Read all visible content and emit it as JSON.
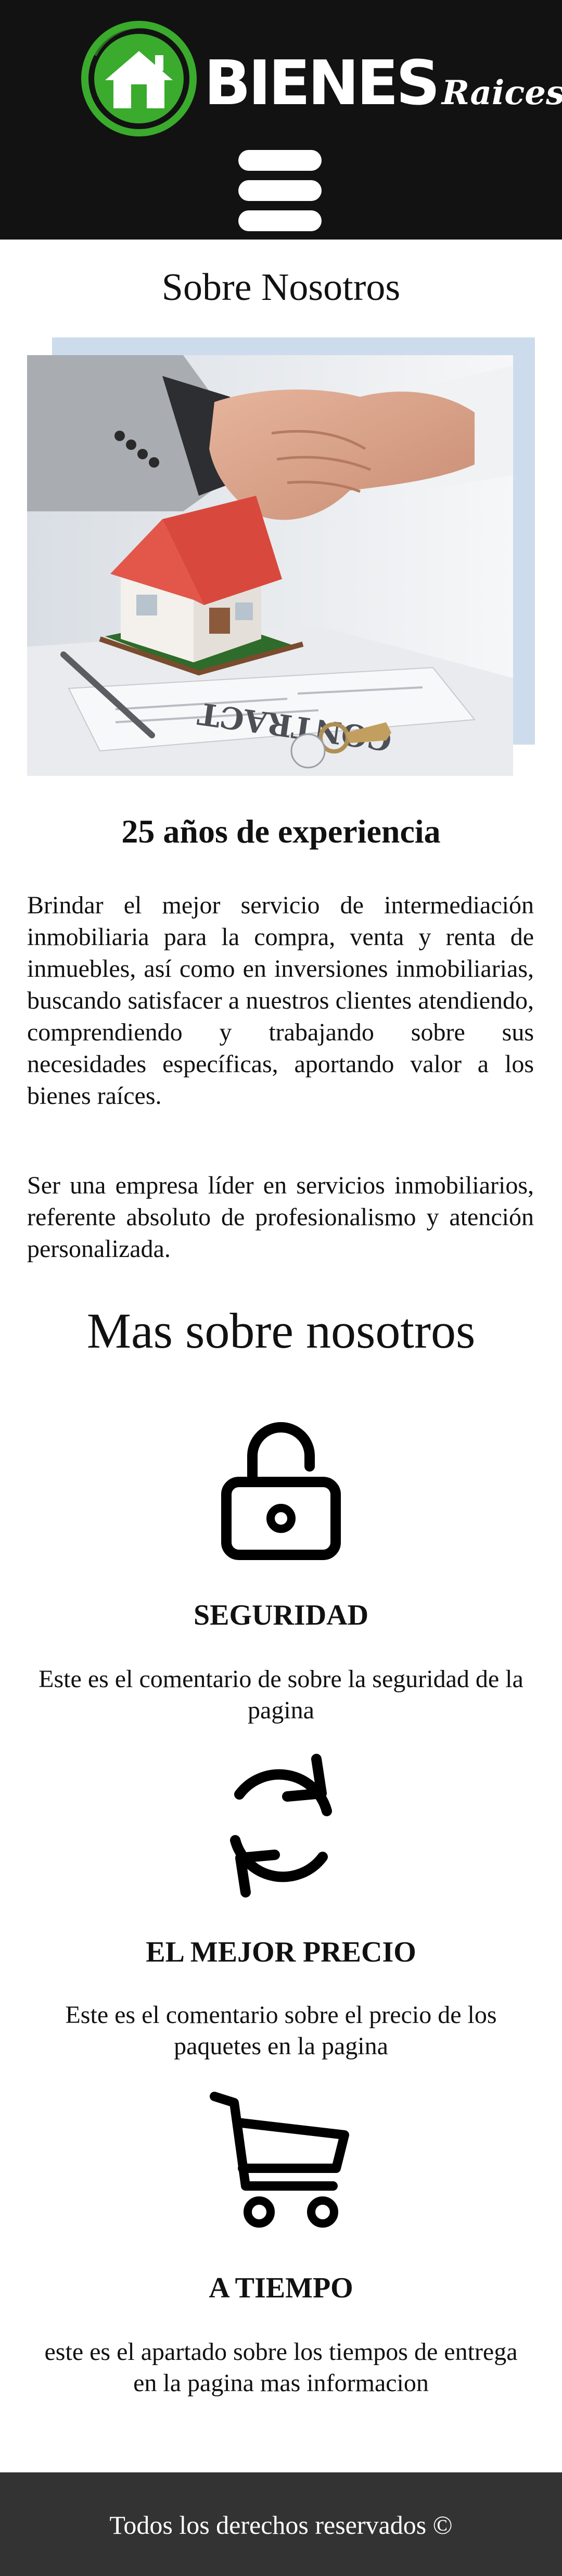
{
  "header": {
    "brand_main": "BIENES",
    "brand_sub": "Raices",
    "logo_colors": {
      "ring": "#3aab2c",
      "house": "#ffffff",
      "dark": "#121212"
    }
  },
  "about": {
    "title": "Sobre Nosotros",
    "image_alt": "Apretón de manos sobre contrato con casa en miniatura y llaves",
    "image_lettering": "CONTRACT",
    "experience_title": "25 años de experiencia",
    "paragraph_1": "Brindar el mejor servicio de intermediación inmobiliaria para la compra, venta y renta de inmuebles, así como en inversiones inmobiliarias, buscando satisfacer a nuestros clientes atendiendo, comprendiendo y trabajando sobre sus necesidades específicas, aportando valor a los bienes raíces.",
    "paragraph_2": "Ser una empresa líder en servicios inmobiliarios, referente absoluto de profesionalismo y atención personalizada."
  },
  "more": {
    "title": "Mas sobre nosotros",
    "features": [
      {
        "icon": "lock-icon",
        "title": "SEGURIDAD",
        "text": "Este es el comentario de sobre la seguridad de la pagina"
      },
      {
        "icon": "refresh-icon",
        "title": "EL MEJOR PRECIO",
        "text": "Este es el comentario sobre el precio de los paquetes en la pagina"
      },
      {
        "icon": "cart-icon",
        "title": "A TIEMPO",
        "text": "este es el apartado sobre los tiempos de entrega en la pagina mas informacion"
      }
    ]
  },
  "footer": {
    "text": "Todos los derechos reservados ©"
  }
}
